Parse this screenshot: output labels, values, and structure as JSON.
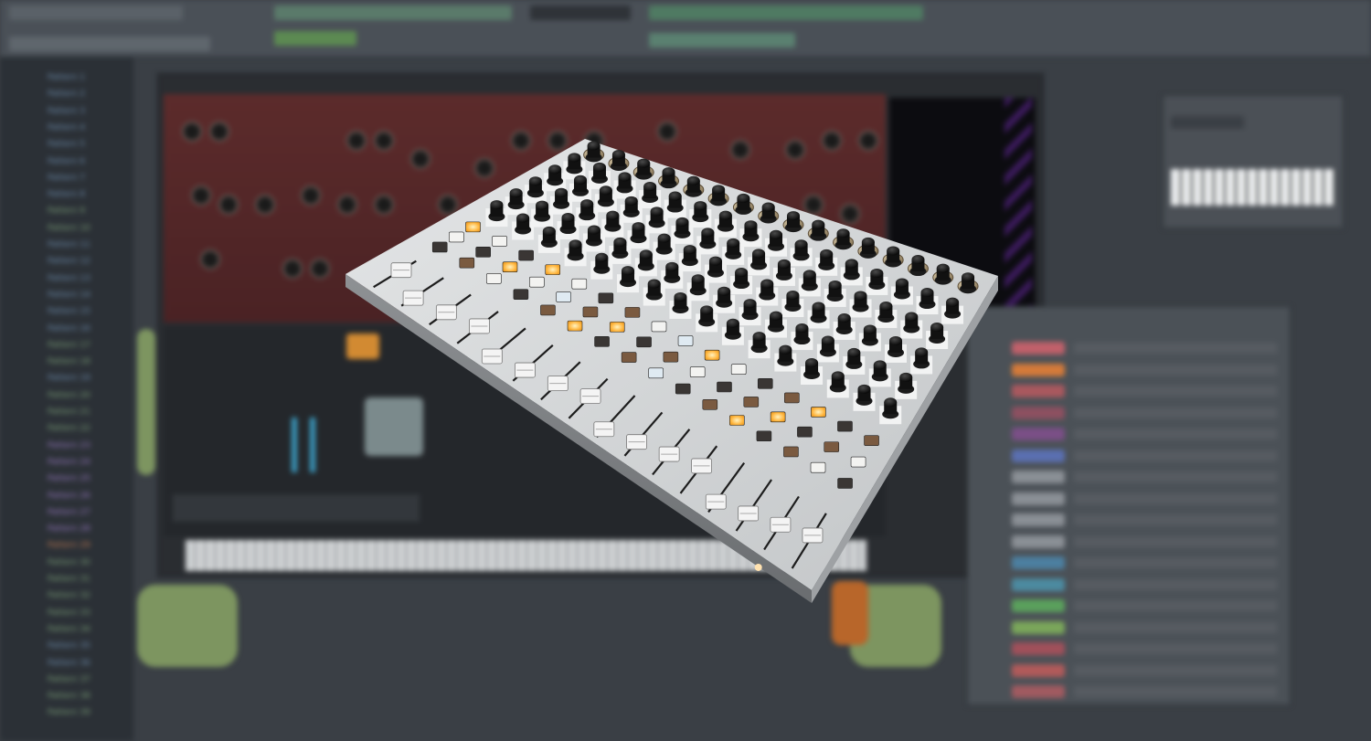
{
  "background": {
    "description_colors": {
      "app_bg": "#3a3f45",
      "panel": "#4b5157",
      "synth_red": "#5c2b2b"
    }
  },
  "sidebar": {
    "items": [
      {
        "label": "Pattern 1",
        "color": "#6f8fb0"
      },
      {
        "label": "Pattern 2",
        "color": "#6f8fb0"
      },
      {
        "label": "Pattern 3",
        "color": "#6f8fb0"
      },
      {
        "label": "Pattern 4",
        "color": "#6f8fb0"
      },
      {
        "label": "Pattern 5",
        "color": "#6f8fb0"
      },
      {
        "label": "Pattern 6",
        "color": "#6f8fb0"
      },
      {
        "label": "Pattern 7",
        "color": "#6f8fb0"
      },
      {
        "label": "Pattern 8",
        "color": "#6f8fb0"
      },
      {
        "label": "Pattern 9",
        "color": "#7da27a"
      },
      {
        "label": "Pattern 10",
        "color": "#7da27a"
      },
      {
        "label": "Pattern 11",
        "color": "#6f8fb0"
      },
      {
        "label": "Pattern 12",
        "color": "#6f8fb0"
      },
      {
        "label": "Pattern 13",
        "color": "#6f8fb0"
      },
      {
        "label": "Pattern 14",
        "color": "#6f8fb0"
      },
      {
        "label": "Pattern 15",
        "color": "#6f8fb0"
      },
      {
        "label": "Pattern 16",
        "color": "#6f8fb0"
      },
      {
        "label": "Pattern 17",
        "color": "#7da27a"
      },
      {
        "label": "Pattern 18",
        "color": "#7da27a"
      },
      {
        "label": "Pattern 19",
        "color": "#6f8fb0"
      },
      {
        "label": "Pattern 20",
        "color": "#7da27a"
      },
      {
        "label": "Pattern 21",
        "color": "#7da27a"
      },
      {
        "label": "Pattern 22",
        "color": "#7da27a"
      },
      {
        "label": "Pattern 23",
        "color": "#9a7bc4"
      },
      {
        "label": "Pattern 24",
        "color": "#9a7bc4"
      },
      {
        "label": "Pattern 25",
        "color": "#9a7bc4"
      },
      {
        "label": "Pattern 26",
        "color": "#9a7bc4"
      },
      {
        "label": "Pattern 27",
        "color": "#9a7bc4"
      },
      {
        "label": "Pattern 28",
        "color": "#9a7bc4"
      },
      {
        "label": "Pattern 29",
        "color": "#c27c54"
      },
      {
        "label": "Pattern 30",
        "color": "#7da27a"
      },
      {
        "label": "Pattern 31",
        "color": "#7da27a"
      },
      {
        "label": "Pattern 32",
        "color": "#7da27a"
      },
      {
        "label": "Pattern 33",
        "color": "#7da27a"
      },
      {
        "label": "Pattern 34",
        "color": "#7da27a"
      },
      {
        "label": "Pattern 35",
        "color": "#6f8fb0"
      },
      {
        "label": "Pattern 36",
        "color": "#6f8fb0"
      },
      {
        "label": "Pattern 37",
        "color": "#7da27a"
      },
      {
        "label": "Pattern 38",
        "color": "#7da27a"
      },
      {
        "label": "Pattern 39",
        "color": "#7da27a"
      }
    ]
  },
  "channel_rack": {
    "buttons": [
      {
        "color": "#c0606a"
      },
      {
        "color": "#d47a3a"
      },
      {
        "color": "#a9585e"
      },
      {
        "color": "#8c5060"
      },
      {
        "color": "#7a4f86"
      },
      {
        "color": "#5a6fb0"
      },
      {
        "color": "#8a8f95"
      },
      {
        "color": "#8a8f95"
      },
      {
        "color": "#8a8f95"
      },
      {
        "color": "#8a8f95"
      },
      {
        "color": "#4c7fa0"
      },
      {
        "color": "#4c8aa0"
      },
      {
        "color": "#5aa05c"
      },
      {
        "color": "#7aa65a"
      },
      {
        "color": "#a0505a"
      },
      {
        "color": "#b05a5a"
      },
      {
        "color": "#a05a60"
      }
    ]
  },
  "controller": {
    "body_color": "#c9cbcd",
    "knob_rows": 6,
    "knobs_per_row": 16,
    "fader_count": 16,
    "lit_button_color": "#ffb43a"
  }
}
